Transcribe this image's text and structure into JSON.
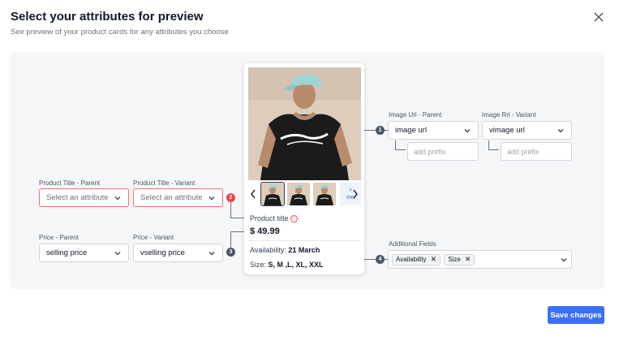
{
  "header": {
    "title": "Select your attributes for preview",
    "subtitle": "See preview of your product cards for any attributes you choose"
  },
  "image_url": {
    "parent_label": "Image Url - Parent",
    "parent_value": "image url",
    "variant_label": "Image Rrl - Variant",
    "variant_value": "vimage url",
    "parent_prefix_placeholder": "add prefix",
    "variant_prefix_placeholder": "add prefix",
    "badge": "1"
  },
  "product_title": {
    "parent_label": "Product Title - Parent",
    "parent_placeholder": "Select an attribute",
    "variant_label": "Product Title - Variant",
    "variant_placeholder": "Select an attribute",
    "badge": "2"
  },
  "price": {
    "parent_label": "Price - Parent",
    "parent_value": "selling price",
    "variant_label": "Price - Variant",
    "variant_value": "vselling price",
    "badge": "3"
  },
  "additional_fields": {
    "label": "Additional Fields",
    "chips": [
      "Availability",
      "Size"
    ],
    "badge": "4"
  },
  "card": {
    "more_label_1": "+",
    "more_label_2": "mo",
    "title": "Product title",
    "price": "$ 49.99",
    "availability_label": "Availability:",
    "availability_value": "21 March",
    "size_label": "Size:",
    "size_value": "S, M ,L, XL, XXL"
  },
  "footer": {
    "save_label": "Save changes"
  },
  "colors": {
    "accent": "#3b6ff5",
    "error": "#ef4444",
    "canvas": "#f5f6f8"
  }
}
